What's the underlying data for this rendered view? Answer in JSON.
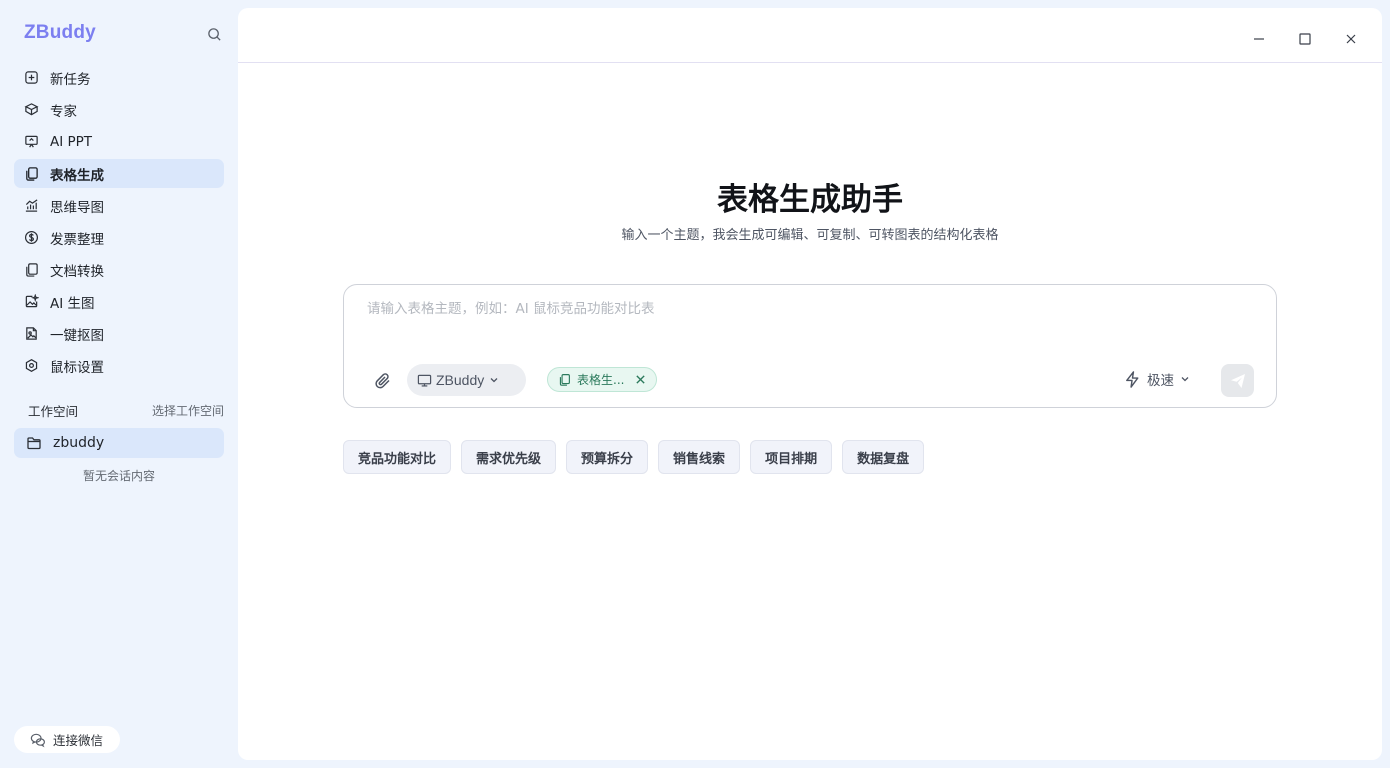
{
  "sidebar": {
    "brand": "ZBuddy",
    "items": [
      {
        "label": "新任务",
        "icon": "plus-square-icon",
        "active": false
      },
      {
        "label": "专家",
        "icon": "cube-icon",
        "active": false
      },
      {
        "label": "AI PPT",
        "icon": "presentation-icon",
        "active": false
      },
      {
        "label": "表格生成",
        "icon": "copy-doc-icon",
        "active": true
      },
      {
        "label": "思维导图",
        "icon": "chart-icon",
        "active": false
      },
      {
        "label": "发票整理",
        "icon": "dollar-circle-icon",
        "active": false
      },
      {
        "label": "文档转换",
        "icon": "doc-convert-icon",
        "active": false
      },
      {
        "label": "AI 生图",
        "icon": "image-sparkle-icon",
        "active": false
      },
      {
        "label": "一键抠图",
        "icon": "image-file-icon",
        "active": false
      },
      {
        "label": "鼠标设置",
        "icon": "hexagon-settings-icon",
        "active": false
      }
    ],
    "workspace": {
      "title": "工作空间",
      "select_label": "选择工作空间",
      "current": "zbuddy",
      "empty_text": "暂无会话内容"
    },
    "wechat_label": "连接微信"
  },
  "main": {
    "title": "表格生成助手",
    "subtitle": "输入一个主题，我会生成可编辑、可复制、可转图表的结构化表格",
    "composer": {
      "placeholder": "请输入表格主题，例如：AI 鼠标竞品功能对比表",
      "model": "ZBuddy",
      "tool_chip": "表格生...",
      "speed": "极速"
    },
    "suggestions": [
      "竞品功能对比",
      "需求优先级",
      "预算拆分",
      "销售线索",
      "项目排期",
      "数据复盘"
    ]
  },
  "colors": {
    "brand": "#7c7ff0",
    "active_bg": "#dae7fb",
    "tool_chip_bg": "#e8f7f1",
    "tool_chip_text": "#2b7a5c"
  }
}
